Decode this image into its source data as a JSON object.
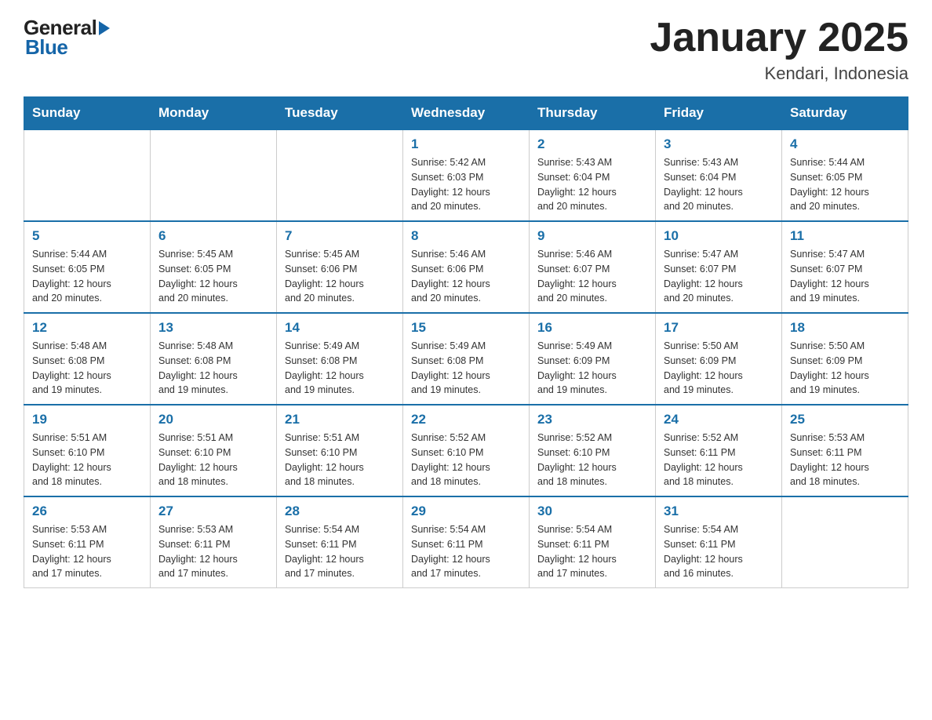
{
  "header": {
    "logo_general": "General",
    "logo_arrow": "▶",
    "logo_blue": "Blue",
    "calendar_title": "January 2025",
    "calendar_subtitle": "Kendari, Indonesia"
  },
  "days_of_week": [
    "Sunday",
    "Monday",
    "Tuesday",
    "Wednesday",
    "Thursday",
    "Friday",
    "Saturday"
  ],
  "weeks": [
    [
      {
        "day": "",
        "info": ""
      },
      {
        "day": "",
        "info": ""
      },
      {
        "day": "",
        "info": ""
      },
      {
        "day": "1",
        "info": "Sunrise: 5:42 AM\nSunset: 6:03 PM\nDaylight: 12 hours\nand 20 minutes."
      },
      {
        "day": "2",
        "info": "Sunrise: 5:43 AM\nSunset: 6:04 PM\nDaylight: 12 hours\nand 20 minutes."
      },
      {
        "day": "3",
        "info": "Sunrise: 5:43 AM\nSunset: 6:04 PM\nDaylight: 12 hours\nand 20 minutes."
      },
      {
        "day": "4",
        "info": "Sunrise: 5:44 AM\nSunset: 6:05 PM\nDaylight: 12 hours\nand 20 minutes."
      }
    ],
    [
      {
        "day": "5",
        "info": "Sunrise: 5:44 AM\nSunset: 6:05 PM\nDaylight: 12 hours\nand 20 minutes."
      },
      {
        "day": "6",
        "info": "Sunrise: 5:45 AM\nSunset: 6:05 PM\nDaylight: 12 hours\nand 20 minutes."
      },
      {
        "day": "7",
        "info": "Sunrise: 5:45 AM\nSunset: 6:06 PM\nDaylight: 12 hours\nand 20 minutes."
      },
      {
        "day": "8",
        "info": "Sunrise: 5:46 AM\nSunset: 6:06 PM\nDaylight: 12 hours\nand 20 minutes."
      },
      {
        "day": "9",
        "info": "Sunrise: 5:46 AM\nSunset: 6:07 PM\nDaylight: 12 hours\nand 20 minutes."
      },
      {
        "day": "10",
        "info": "Sunrise: 5:47 AM\nSunset: 6:07 PM\nDaylight: 12 hours\nand 20 minutes."
      },
      {
        "day": "11",
        "info": "Sunrise: 5:47 AM\nSunset: 6:07 PM\nDaylight: 12 hours\nand 19 minutes."
      }
    ],
    [
      {
        "day": "12",
        "info": "Sunrise: 5:48 AM\nSunset: 6:08 PM\nDaylight: 12 hours\nand 19 minutes."
      },
      {
        "day": "13",
        "info": "Sunrise: 5:48 AM\nSunset: 6:08 PM\nDaylight: 12 hours\nand 19 minutes."
      },
      {
        "day": "14",
        "info": "Sunrise: 5:49 AM\nSunset: 6:08 PM\nDaylight: 12 hours\nand 19 minutes."
      },
      {
        "day": "15",
        "info": "Sunrise: 5:49 AM\nSunset: 6:08 PM\nDaylight: 12 hours\nand 19 minutes."
      },
      {
        "day": "16",
        "info": "Sunrise: 5:49 AM\nSunset: 6:09 PM\nDaylight: 12 hours\nand 19 minutes."
      },
      {
        "day": "17",
        "info": "Sunrise: 5:50 AM\nSunset: 6:09 PM\nDaylight: 12 hours\nand 19 minutes."
      },
      {
        "day": "18",
        "info": "Sunrise: 5:50 AM\nSunset: 6:09 PM\nDaylight: 12 hours\nand 19 minutes."
      }
    ],
    [
      {
        "day": "19",
        "info": "Sunrise: 5:51 AM\nSunset: 6:10 PM\nDaylight: 12 hours\nand 18 minutes."
      },
      {
        "day": "20",
        "info": "Sunrise: 5:51 AM\nSunset: 6:10 PM\nDaylight: 12 hours\nand 18 minutes."
      },
      {
        "day": "21",
        "info": "Sunrise: 5:51 AM\nSunset: 6:10 PM\nDaylight: 12 hours\nand 18 minutes."
      },
      {
        "day": "22",
        "info": "Sunrise: 5:52 AM\nSunset: 6:10 PM\nDaylight: 12 hours\nand 18 minutes."
      },
      {
        "day": "23",
        "info": "Sunrise: 5:52 AM\nSunset: 6:10 PM\nDaylight: 12 hours\nand 18 minutes."
      },
      {
        "day": "24",
        "info": "Sunrise: 5:52 AM\nSunset: 6:11 PM\nDaylight: 12 hours\nand 18 minutes."
      },
      {
        "day": "25",
        "info": "Sunrise: 5:53 AM\nSunset: 6:11 PM\nDaylight: 12 hours\nand 18 minutes."
      }
    ],
    [
      {
        "day": "26",
        "info": "Sunrise: 5:53 AM\nSunset: 6:11 PM\nDaylight: 12 hours\nand 17 minutes."
      },
      {
        "day": "27",
        "info": "Sunrise: 5:53 AM\nSunset: 6:11 PM\nDaylight: 12 hours\nand 17 minutes."
      },
      {
        "day": "28",
        "info": "Sunrise: 5:54 AM\nSunset: 6:11 PM\nDaylight: 12 hours\nand 17 minutes."
      },
      {
        "day": "29",
        "info": "Sunrise: 5:54 AM\nSunset: 6:11 PM\nDaylight: 12 hours\nand 17 minutes."
      },
      {
        "day": "30",
        "info": "Sunrise: 5:54 AM\nSunset: 6:11 PM\nDaylight: 12 hours\nand 17 minutes."
      },
      {
        "day": "31",
        "info": "Sunrise: 5:54 AM\nSunset: 6:11 PM\nDaylight: 12 hours\nand 16 minutes."
      },
      {
        "day": "",
        "info": ""
      }
    ]
  ]
}
